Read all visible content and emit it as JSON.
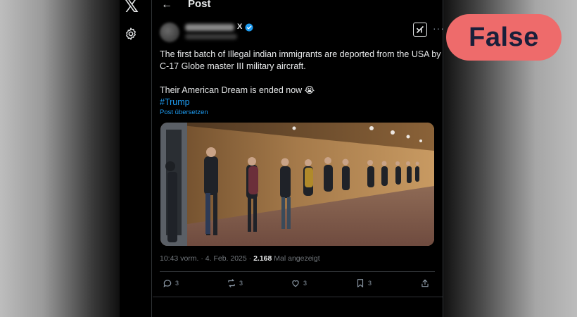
{
  "header": {
    "title": "Post"
  },
  "rail": {
    "logo": "𝕏"
  },
  "author": {
    "badge": "X"
  },
  "tweet": {
    "line1": "The first batch of Illegal indian immigrants are deported from the USA by",
    "line2": "C-17 Globe master III military aircraft.",
    "line3": "Their American Dream is ended now 😭",
    "hashtag": "#Trump",
    "translate": "Post übersetzen"
  },
  "meta": {
    "time": "10:43 vorm. · 4. Feb. 2025 · ",
    "views_count": "2.168",
    "views_label": " Mal angezeigt"
  },
  "actions": {
    "replies": "3",
    "reposts": "3",
    "likes": "3",
    "bookmarks": "3"
  },
  "verdict": {
    "label": "False",
    "color": "#ee6b6b"
  },
  "colors": {
    "accent": "#1d9bf0",
    "background": "#000000",
    "text": "#e7e9ea",
    "muted": "#71767b"
  }
}
